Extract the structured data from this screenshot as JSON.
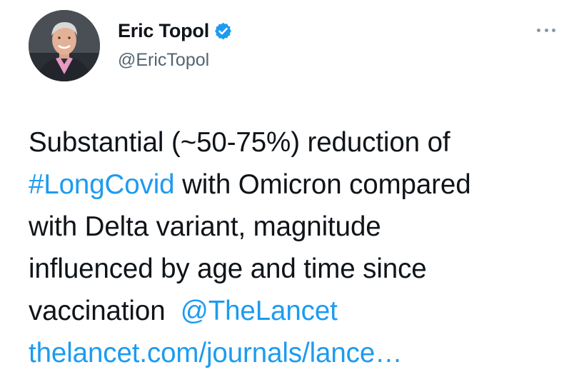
{
  "author": {
    "display_name": "Eric Topol",
    "handle": "@EricTopol",
    "verified": true,
    "avatar_icon": "profile-photo"
  },
  "menu": {
    "icon": "more-options-icon"
  },
  "tweet": {
    "line1": "Substantial (~50-75%) reduction of",
    "hashtag": "#LongCovid",
    "line2_rest": " with Omicron compared",
    "line3": "with Delta variant, magnitude",
    "line4": "influenced by age and time since",
    "line5_text": "vaccination  ",
    "mention": "@TheLancet",
    "url": "thelancet.com/journals/lance…"
  },
  "colors": {
    "link": "#1d9bf0",
    "text": "#0f1419",
    "secondary": "#536471",
    "verified_badge": "#1d9bf0"
  }
}
